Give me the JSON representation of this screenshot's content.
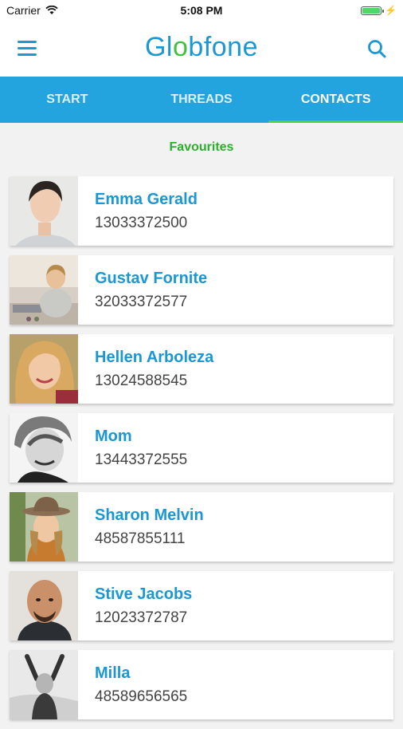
{
  "status_bar": {
    "carrier": "Carrier",
    "time": "5:08 PM",
    "battery_level": 1.0
  },
  "header": {
    "logo_text_start": "Gl",
    "logo_text_accent": "o",
    "logo_text_end": "bfone",
    "menu_icon": "hamburger-icon",
    "search_icon": "search-icon"
  },
  "tabs": [
    {
      "label": "START",
      "active": false
    },
    {
      "label": "THREADS",
      "active": false
    },
    {
      "label": "CONTACTS",
      "active": true
    }
  ],
  "section_title": "Favourites",
  "contacts": [
    {
      "name": "Emma Gerald",
      "phone": "13033372500"
    },
    {
      "name": "Gustav Fornite",
      "phone": "32033372577"
    },
    {
      "name": "Hellen Arboleza",
      "phone": "13024588545"
    },
    {
      "name": "Mom",
      "phone": "13443372555"
    },
    {
      "name": "Sharon Melvin",
      "phone": "48587855111"
    },
    {
      "name": "Stive Jacobs",
      "phone": "12023372787"
    },
    {
      "name": "Milla",
      "phone": "48589656565"
    }
  ],
  "colors": {
    "brand_blue": "#1b97d1",
    "tab_bar": "#23a4de",
    "accent_green": "#3ec23f"
  }
}
